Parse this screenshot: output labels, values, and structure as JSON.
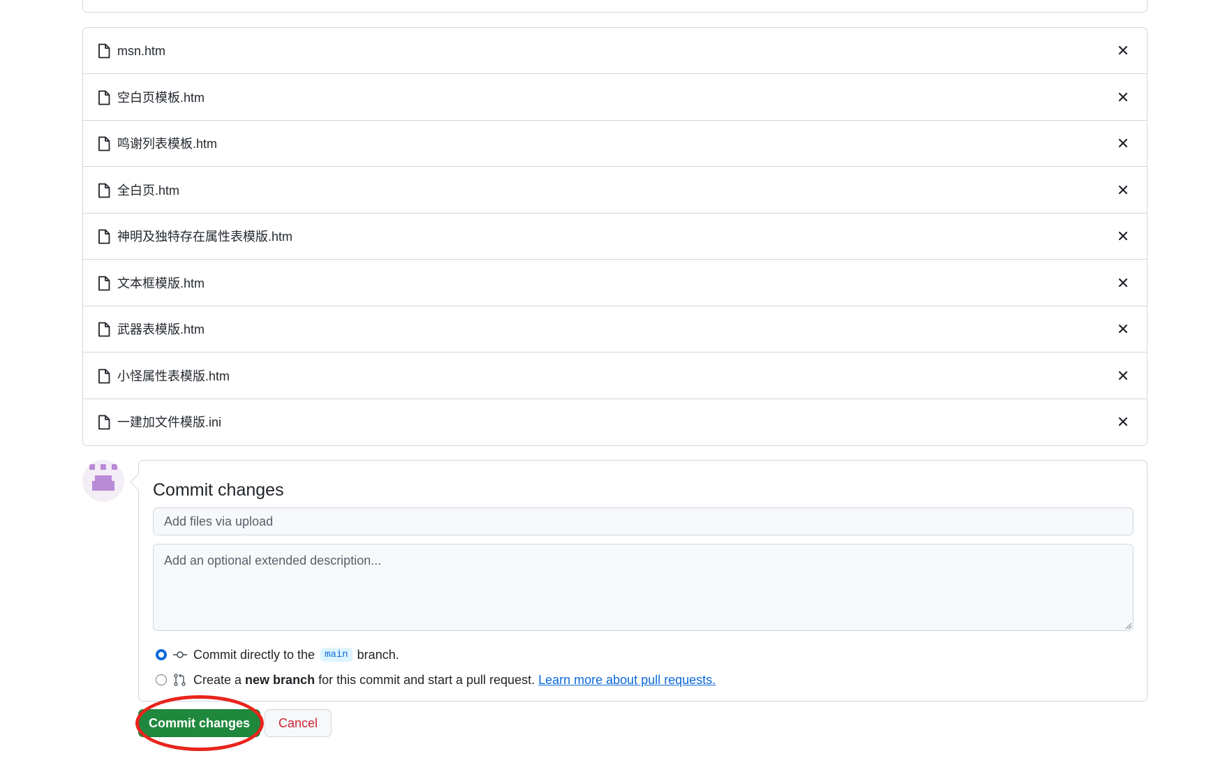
{
  "files": [
    {
      "name": "msn.htm"
    },
    {
      "name": "空白页模板.htm"
    },
    {
      "name": "鸣谢列表模板.htm"
    },
    {
      "name": "全白页.htm"
    },
    {
      "name": "神明及独特存在属性表模版.htm"
    },
    {
      "name": "文本框模版.htm"
    },
    {
      "name": "武器表模版.htm"
    },
    {
      "name": "小怪属性表模版.htm"
    },
    {
      "name": "一建加文件模版.ini"
    }
  ],
  "file_icon": "file-icon",
  "remove_icon": "x-icon",
  "commit": {
    "title": "Commit changes",
    "summary_placeholder": "Add files via upload",
    "description_placeholder": "Add an optional extended description...",
    "option_direct": {
      "prefix": "Commit directly to the",
      "branch": "main",
      "suffix": "branch.",
      "selected": true
    },
    "option_new_branch": {
      "prefix": "Create a",
      "bold": "new branch",
      "suffix": "for this commit and start a pull request.",
      "link": "Learn more about pull requests.",
      "selected": false
    }
  },
  "buttons": {
    "commit_label": "Commit changes",
    "cancel_label": "Cancel"
  },
  "colors": {
    "primary_green": "#1f883d",
    "danger_red": "#cf222e",
    "link_blue": "#0969da",
    "annotation_red": "#e8241c",
    "avatar_purple": "#b98ad6"
  }
}
